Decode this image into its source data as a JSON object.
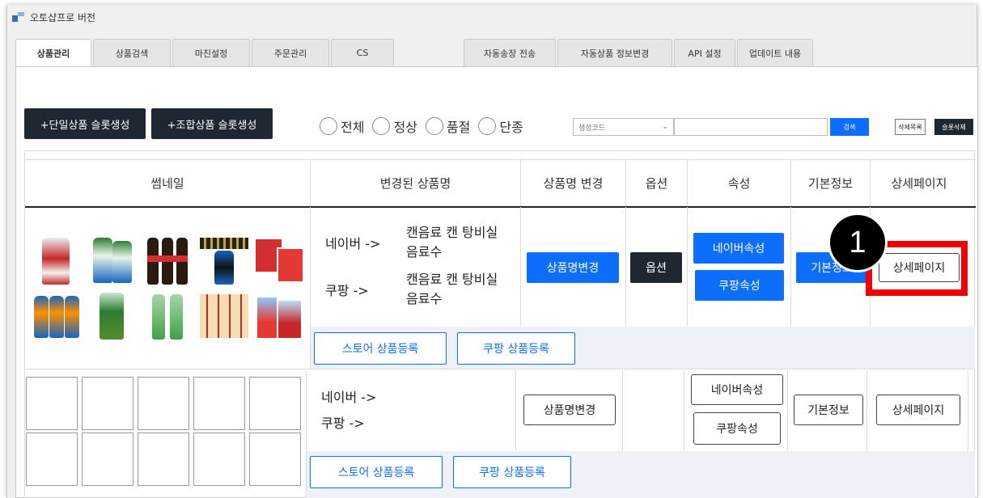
{
  "window": {
    "title": "오토샵프로 버전"
  },
  "tabs": {
    "left": [
      "상품관리",
      "상품검색",
      "마진설정",
      "주문관리",
      "CS"
    ],
    "right": [
      "자동송장 전송",
      "자동상품 정보변경",
      "API 설정",
      "업데이트 내용"
    ],
    "active": "상품관리"
  },
  "toolbar": {
    "single_slot_btn": "+단일상품 슬롯생성",
    "combo_slot_btn": "+조합상품 슬롯생성",
    "radios": [
      "전체",
      "정상",
      "품절",
      "단종"
    ],
    "select_placeholder": "생성코드",
    "search_btn": "검색",
    "delete_list_btn": "삭제목록",
    "slot_delete_btn": "슬롯삭제"
  },
  "table": {
    "headers": [
      "썸네일",
      "변경된 상품명",
      "상품명 변경",
      "옵션",
      "속성",
      "기본정보",
      "상세페이지"
    ],
    "rows": [
      {
        "naver_label": "네이버 ->",
        "naver_name": "캔음료 캔 탕비실 음료수",
        "coupang_label": "쿠팡   ->",
        "coupang_name": "캔음료 캔 탕비실 음료수",
        "rename_btn": "상품명변경",
        "option_btn": "옵션",
        "naver_attr_btn": "네이버속성",
        "coupang_attr_btn": "쿠팡속성",
        "basic_info_btn": "기본정보",
        "detail_page_btn": "상세페이지",
        "store_register_btn": "스토어 상품등록",
        "coupang_register_btn": "쿠팡 상품등록"
      },
      {
        "naver_label": "네이버 ->",
        "coupang_label": "쿠팡   ->",
        "rename_btn": "상품명변경",
        "naver_attr_btn": "네이버속성",
        "coupang_attr_btn": "쿠팡속성",
        "basic_info_btn": "기본정보",
        "detail_page_btn": "상세페이지",
        "store_register_btn": "스토어 상품등록",
        "coupang_register_btn": "쿠팡 상품등록"
      }
    ]
  },
  "annotation": {
    "step_number": "1",
    "highlight_color": "#f00000"
  },
  "colors": {
    "primary": "#0d6efd",
    "dark": "#1f2733"
  }
}
